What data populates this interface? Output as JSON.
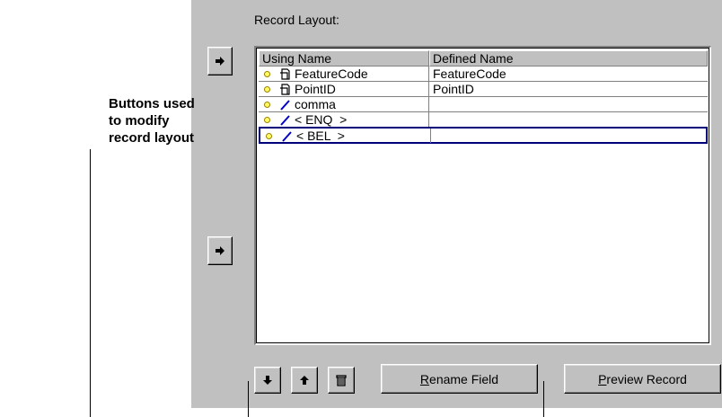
{
  "record_layout_label": "Record Layout:",
  "columns": {
    "using_name": "Using Name",
    "defined_name": "Defined Name"
  },
  "rows": [
    {
      "using_name": "FeatureCode",
      "defined_name": "FeatureCode",
      "icon": "field-icon"
    },
    {
      "using_name": "PointID",
      "defined_name": "PointID",
      "icon": "field-icon"
    },
    {
      "using_name": "comma",
      "defined_name": "",
      "icon": "separator-icon"
    },
    {
      "using_name": "< ENQ  >",
      "defined_name": "",
      "icon": "separator-icon"
    },
    {
      "using_name": "< BEL  >",
      "defined_name": "",
      "icon": "separator-icon",
      "selected": true
    }
  ],
  "buttons": {
    "rename_field": "Rename Field",
    "rename_field_accel": "R",
    "rename_field_rest": "ename Field",
    "preview_record": "Preview Record",
    "preview_record_accel": "P",
    "preview_record_rest": "review Record"
  },
  "annotation": {
    "line1": "Buttons used",
    "line2": "to modify",
    "line3": "record layout"
  },
  "colors": {
    "panel": "#c0c0c0",
    "selection_border": "#00007a",
    "bullet": "#ffff60"
  }
}
